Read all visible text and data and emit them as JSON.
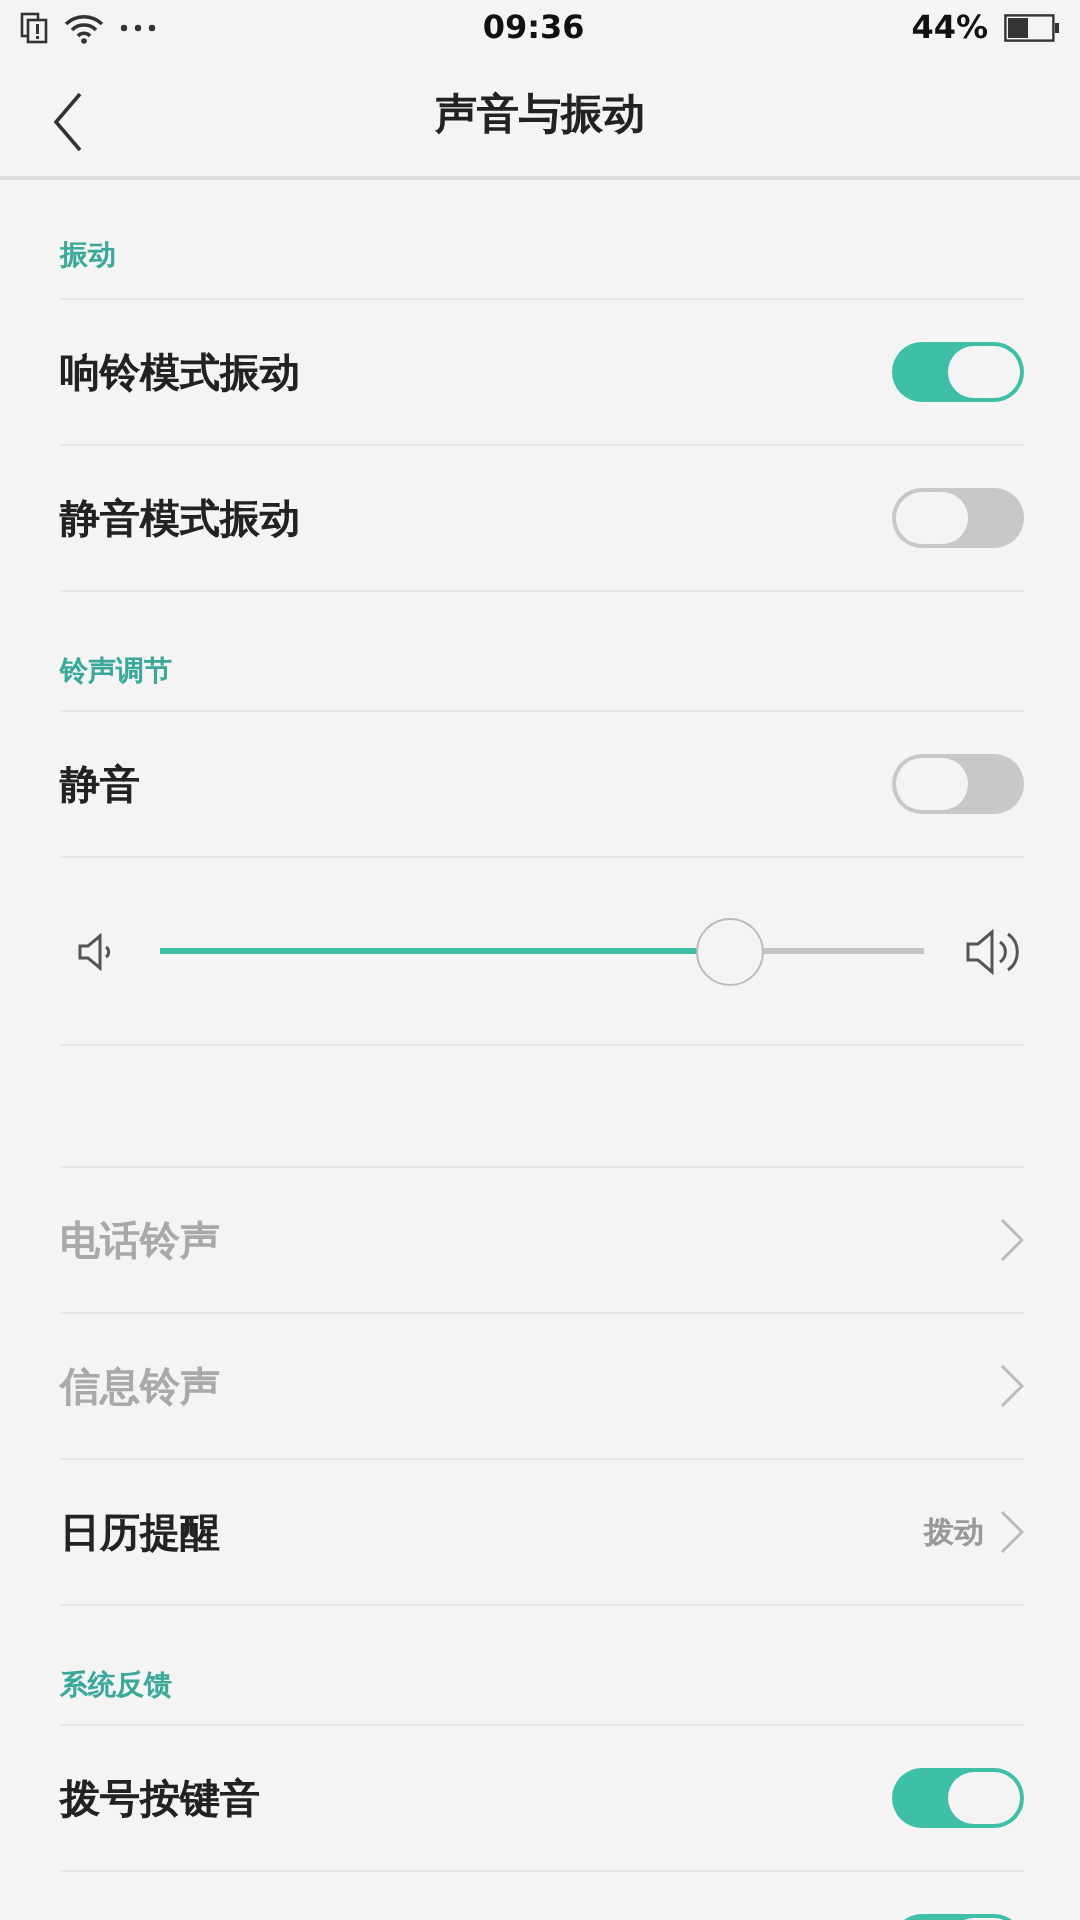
{
  "status_bar": {
    "time": "09:36",
    "battery_text": "44%"
  },
  "header": {
    "title": "声音与振动"
  },
  "items": [
    {
      "kind": "section",
      "label": "振动"
    },
    {
      "kind": "toggle",
      "label": "响铃模式振动",
      "on": true
    },
    {
      "kind": "toggle",
      "label": "静音模式振动",
      "on": false
    },
    {
      "kind": "section",
      "label": "铃声调节"
    },
    {
      "kind": "toggle",
      "label": "静音",
      "on": false
    },
    {
      "kind": "slider",
      "level": 0.745
    },
    {
      "kind": "spacer"
    },
    {
      "kind": "link",
      "label": "电话铃声",
      "disabled": true
    },
    {
      "kind": "link",
      "label": "信息铃声",
      "disabled": true
    },
    {
      "kind": "link",
      "label": "日历提醒",
      "value": "拨动",
      "disabled": false
    },
    {
      "kind": "section",
      "label": "系统反馈"
    },
    {
      "kind": "toggle",
      "label": "拨号按键音",
      "on": true
    },
    {
      "kind": "toggle",
      "on": true
    }
  ]
}
